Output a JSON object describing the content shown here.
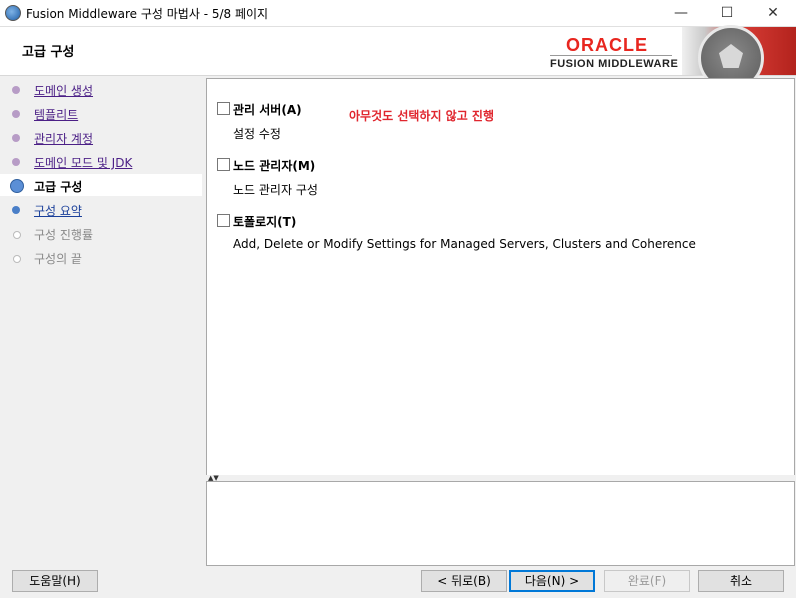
{
  "window": {
    "title": "Fusion Middleware 구성 마법사 - 5/8 페이지",
    "minimize": "—",
    "maximize": "☐",
    "close": "✕"
  },
  "header": {
    "heading": "고급 구성",
    "brand": "ORACLE",
    "brand_sub": "FUSION MIDDLEWARE"
  },
  "sidebar": {
    "items": [
      {
        "label": "도메인 생성",
        "state": "done"
      },
      {
        "label": "템플리트",
        "state": "done"
      },
      {
        "label": "관리자 계정",
        "state": "done"
      },
      {
        "label": "도메인 모드 및 JDK",
        "state": "done"
      },
      {
        "label": "고급 구성",
        "state": "current"
      },
      {
        "label": "구성 요약",
        "state": "next"
      },
      {
        "label": "구성 진행률",
        "state": "future"
      },
      {
        "label": "구성의 끝",
        "state": "future"
      }
    ]
  },
  "main": {
    "options": [
      {
        "label": "관리 서버(A)",
        "description": "설정 수정",
        "checked": false
      },
      {
        "label": "노드 관리자(M)",
        "description": "노드 관리자 구성",
        "checked": false
      },
      {
        "label": "토폴로지(T)",
        "description": "Add, Delete or Modify Settings for Managed Servers, Clusters and Coherence",
        "checked": false
      }
    ],
    "annotation": "아무것도 선택하지 않고 진행"
  },
  "footer": {
    "help": "도움말(H)",
    "back": "< 뒤로(B)",
    "next": "다음(N) >",
    "finish": "완료(F)",
    "cancel": "취소"
  }
}
